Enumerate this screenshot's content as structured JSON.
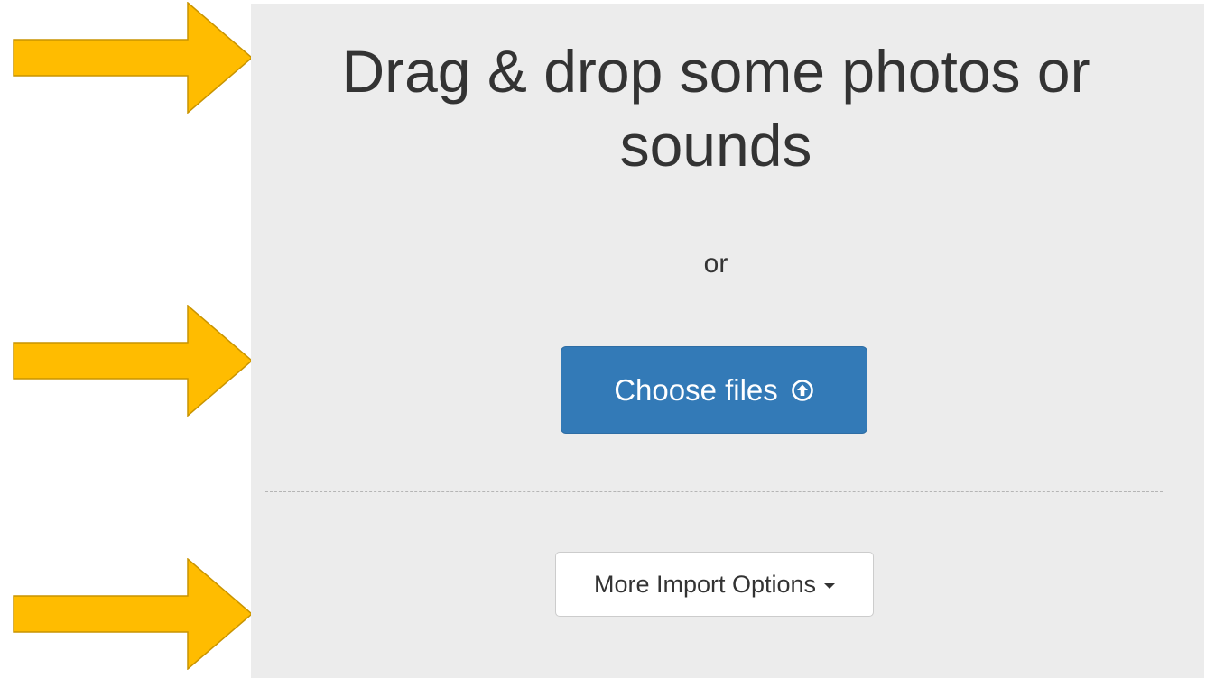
{
  "annotations": {
    "arrow_color": "#ffbc00",
    "arrow_outline_color": "#c99400",
    "arrows": [
      {
        "icon": "arrow-right-icon"
      },
      {
        "icon": "arrow-right-icon"
      },
      {
        "icon": "arrow-right-icon"
      }
    ]
  },
  "dropzone": {
    "background": "#ececec",
    "heading_line1": "Drag & drop some photos or",
    "heading_line2": "sounds",
    "or_text": "or",
    "choose_button": {
      "label": "Choose files",
      "icon": "upload-circle-icon",
      "color": "#337ab7"
    },
    "more_button": {
      "label": "More Import Options",
      "icon": "caret-down-icon"
    }
  }
}
